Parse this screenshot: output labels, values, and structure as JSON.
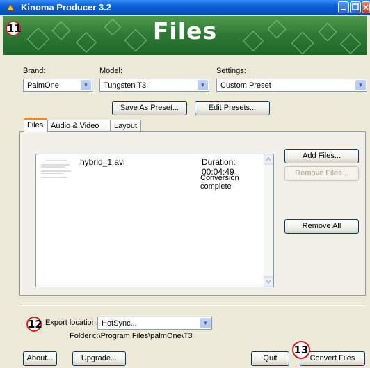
{
  "window": {
    "title": "Kinoma Producer 3.2"
  },
  "banner": {
    "title": "Files"
  },
  "callouts": [
    "11",
    "12",
    "13"
  ],
  "brand": {
    "label": "Brand:",
    "value": "PalmOne"
  },
  "model": {
    "label": "Model:",
    "value": "Tungsten T3"
  },
  "settings": {
    "label": "Settings:",
    "value": "Custom Preset"
  },
  "presets": {
    "save_label": "Save As Preset...",
    "edit_label": "Edit Presets..."
  },
  "tabs": [
    {
      "label": "Files"
    },
    {
      "label": "Audio & Video"
    },
    {
      "label": "Layout"
    }
  ],
  "file_list": {
    "items": [
      {
        "name": "hybrid_1.avi",
        "duration": "Duration: 00:04:49",
        "status": "Conversion complete"
      }
    ]
  },
  "file_buttons": {
    "add": "Add Files...",
    "remove": "Remove Files...",
    "remove_all": "Remove All"
  },
  "export": {
    "label": "Export location:",
    "value": "HotSync...",
    "folder_label": "Folder:",
    "folder_path": "c:\\Program Files\\palmOne\\T3"
  },
  "footer": {
    "about": "About...",
    "upgrade": "Upgrade...",
    "quit": "Quit",
    "convert": "Convert Files"
  },
  "colors": {
    "titlebar": "#0a5fd8",
    "banner": "#2f7b35",
    "callout_ring": "#d81e1e",
    "window_bg": "#ece9d8"
  }
}
